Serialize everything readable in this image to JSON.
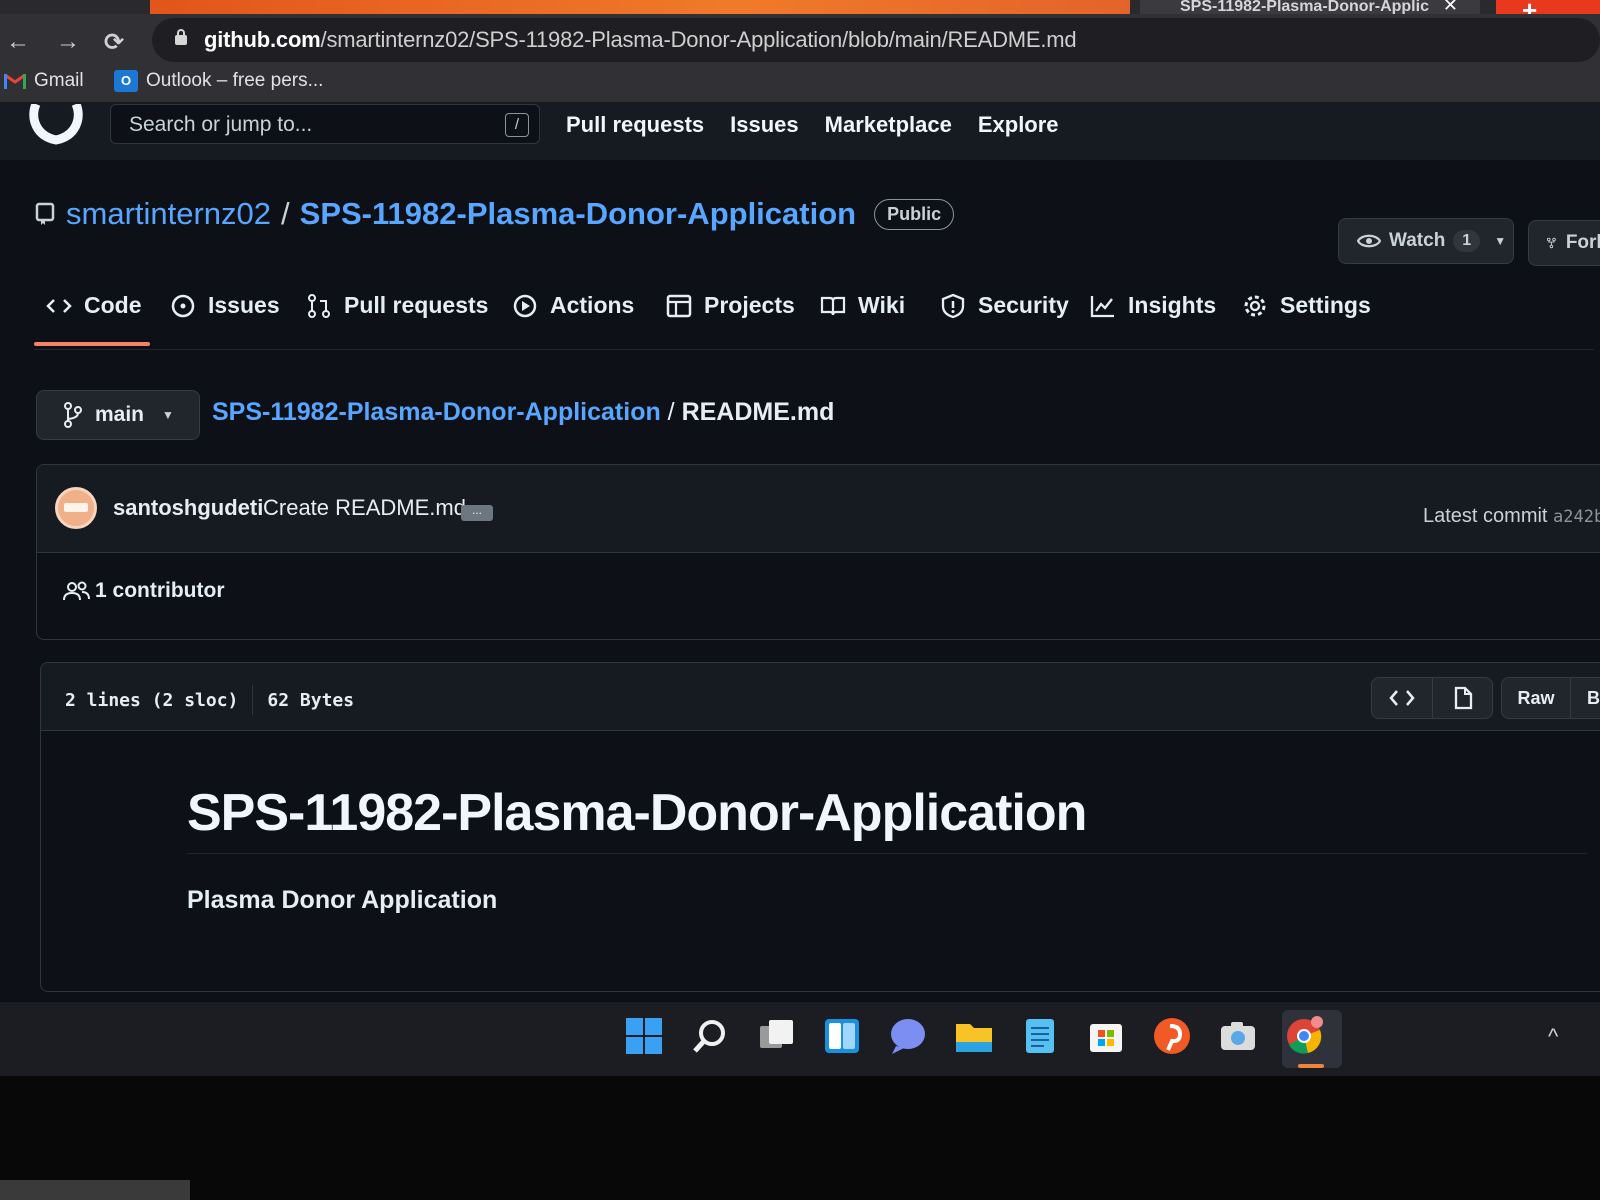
{
  "browser": {
    "other_tab_title": "SPS-11982-Plasma-Donor-Applic",
    "url_host": "github.com",
    "url_path": "/smartinternz02/SPS-11982-Plasma-Donor-Application/blob/main/README.md",
    "bookmarks": [
      {
        "label": "Gmail",
        "icon": "gmail-icon"
      },
      {
        "label": "Outlook – free pers...",
        "icon": "outlook-icon"
      }
    ]
  },
  "header": {
    "search_placeholder": "Search or jump to...",
    "slash_key": "/",
    "nav": [
      "Pull requests",
      "Issues",
      "Marketplace",
      "Explore"
    ]
  },
  "repo": {
    "owner": "smartinternz02",
    "separator": "/",
    "name": "SPS-11982-Plasma-Donor-Application",
    "visibility": "Public",
    "watch_label": "Watch",
    "watch_count": "1",
    "fork_label": "Fork"
  },
  "tabs": [
    {
      "label": "Code",
      "icon": "code-icon"
    },
    {
      "label": "Issues",
      "icon": "issue-opened-icon"
    },
    {
      "label": "Pull requests",
      "icon": "git-pull-request-icon"
    },
    {
      "label": "Actions",
      "icon": "play-icon"
    },
    {
      "label": "Projects",
      "icon": "table-icon"
    },
    {
      "label": "Wiki",
      "icon": "book-icon"
    },
    {
      "label": "Security",
      "icon": "shield-icon"
    },
    {
      "label": "Insights",
      "icon": "graph-icon"
    },
    {
      "label": "Settings",
      "icon": "gear-icon"
    }
  ],
  "breadcrumb": {
    "branch": "main",
    "repo": "SPS-11982-Plasma-Donor-Application",
    "slash": " / ",
    "file": "README.md"
  },
  "commit": {
    "author": "santoshgudeti",
    "message": "Create README.md",
    "ellipsis": "...",
    "latest_label": "Latest commit",
    "sha": "a242b",
    "contributors": "1 contributor"
  },
  "file": {
    "lines": "2 lines (2 sloc)",
    "size": "62 Bytes",
    "raw_label": "Raw",
    "blame_label": "Blame"
  },
  "readme": {
    "heading": "SPS-11982-Plasma-Donor-Application",
    "body": "Plasma Donor Application"
  },
  "colors": {
    "accent_link": "#58a6ff",
    "tab_underline": "#f78166",
    "page_bg": "#0d1117",
    "header_bg": "#161b22"
  }
}
